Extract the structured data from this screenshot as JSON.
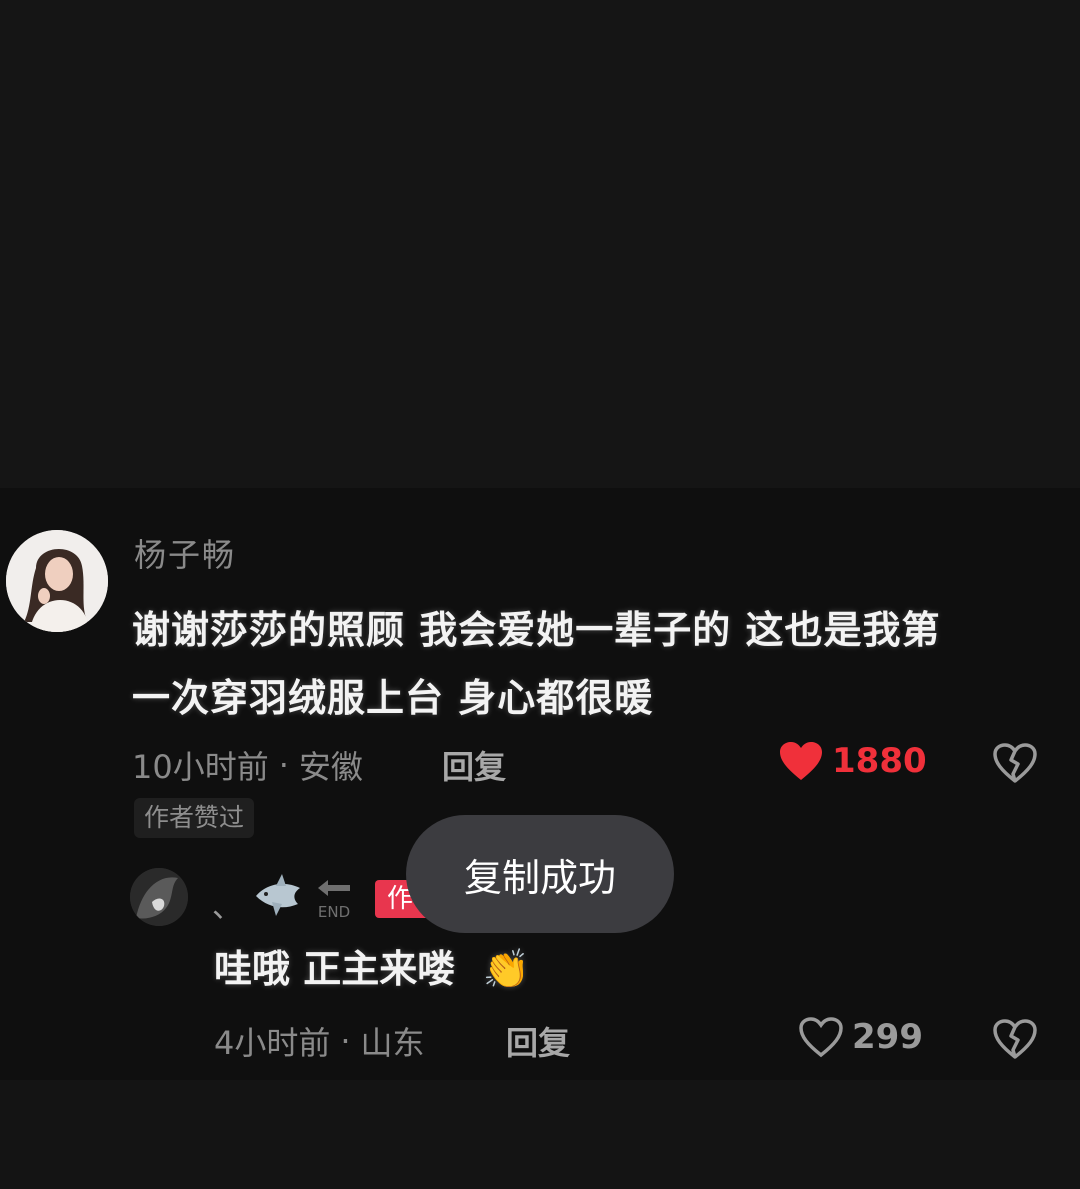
{
  "comment": {
    "username": "杨子畅",
    "text_line1": "谢谢莎莎的照顾 我会爱她一辈子的 这也是我第",
    "text_line2": "一次穿羽绒服上台 身心都很暖",
    "time": "10小时前",
    "location": "安徽",
    "separator": "·",
    "reply_label": "回复",
    "like_count": "1880",
    "author_liked": "作者赞过"
  },
  "toast": {
    "message": "复制成功"
  },
  "reply": {
    "username_mark": "、",
    "end_label": "END",
    "author_badge": "作者",
    "text": "哇哦 正主来喽",
    "emoji": "👏",
    "time": "4小时前",
    "location": "山东",
    "separator": "·",
    "reply_label": "回复",
    "like_count": "299"
  },
  "colors": {
    "like_active": "#f0303a",
    "muted_text": "#8a8a8a",
    "author_badge": "#e8364e"
  }
}
